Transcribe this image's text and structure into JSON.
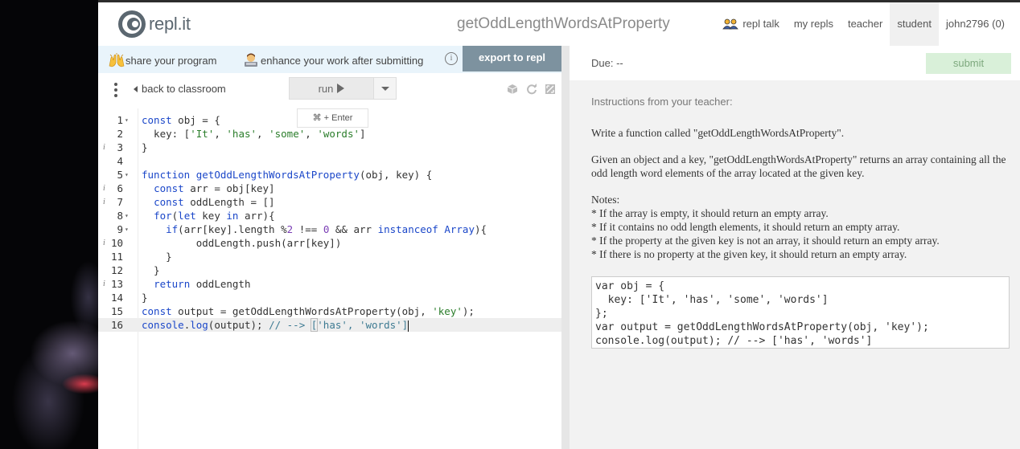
{
  "header": {
    "logo_text": "repl.it",
    "project_title": "getOddLengthWordsAtProperty",
    "nav": [
      {
        "label": "repl talk"
      },
      {
        "label": "my repls"
      },
      {
        "label": "teacher"
      },
      {
        "label": "student",
        "active": true
      },
      {
        "label": "john2796 (0)"
      }
    ]
  },
  "banner": {
    "share_label": "share your program",
    "enhance_label": "enhance your work after submitting",
    "info_glyph": "i",
    "export_label": "export to repl"
  },
  "toolbar": {
    "back_label": "back to classroom",
    "run_label": "run",
    "run_tooltip": "⌘ + Enter"
  },
  "editor": {
    "active_line": 16,
    "lines": [
      {
        "n": "1",
        "text": "const obj = {"
      },
      {
        "n": "2",
        "text": "  key: ['It', 'has', 'some', 'words']"
      },
      {
        "n": "3",
        "text": "}"
      },
      {
        "n": "4",
        "text": ""
      },
      {
        "n": "5",
        "text": "function getOddLengthWordsAtProperty(obj, key) {"
      },
      {
        "n": "6",
        "text": "  const arr = obj[key]"
      },
      {
        "n": "7",
        "text": "  const oddLength = []"
      },
      {
        "n": "8",
        "text": "  for(let key in arr){"
      },
      {
        "n": "9",
        "text": "    if(arr[key].length %2 !== 0 && arr instanceof Array){"
      },
      {
        "n": "10",
        "text": "         oddLength.push(arr[key])"
      },
      {
        "n": "11",
        "text": "    }"
      },
      {
        "n": "12",
        "text": "  }"
      },
      {
        "n": "13",
        "text": "  return oddLength"
      },
      {
        "n": "14",
        "text": "}"
      },
      {
        "n": "15",
        "text": "const output = getOddLengthWordsAtProperty(obj, 'key');"
      },
      {
        "n": "16",
        "text": "console.log(output); // --> ['has', 'words']"
      }
    ]
  },
  "assignment": {
    "due_label": "Due: --",
    "submit_label": "submit",
    "instructions_label": "Instructions from your teacher:",
    "paragraphs": [
      "Write a function called \"getOddLengthWordsAtProperty\".",
      "Given an object and a key, \"getOddLengthWordsAtProperty\" returns an array containing all the odd length word elements of the array located at the given key."
    ],
    "notes_title": "Notes:",
    "notes": [
      "* If the array is empty, it should return an empty array.",
      "* If it contains no odd length elements, it should return an empty array.",
      "* If the property at the given key is not an array, it should return an empty array.",
      "* If there is no property at the given key, it should return an empty array."
    ],
    "example_code": "var obj = {\n  key: ['It', 'has', 'some', 'words']\n};\nvar output = getOddLengthWordsAtProperty(obj, 'key');\nconsole.log(output); // --> ['has', 'words']"
  },
  "colors": {
    "export_button": "#7d929f",
    "submit_button": "#d9f0d9",
    "banner": "#e9f4fb",
    "keyword": "#1b47c9",
    "string": "#2a7d2a"
  },
  "icons": [
    "repl-logo-icon",
    "raised-hands-icon",
    "technologist-icon",
    "info-icon",
    "more-vertical-icon",
    "back-arrow-icon",
    "play-icon",
    "chevron-down-icon",
    "package-icon",
    "refresh-icon",
    "maximize-icon",
    "people-icon"
  ]
}
